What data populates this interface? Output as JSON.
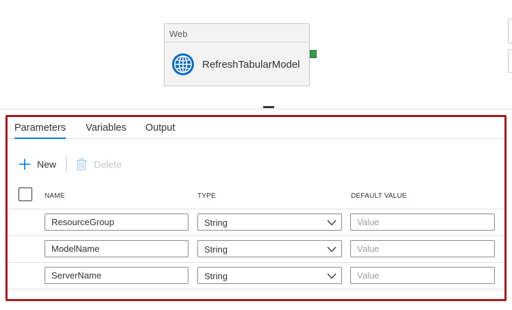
{
  "canvas": {
    "activity": {
      "type_label": "Web",
      "name": "RefreshTabularModel",
      "icon": "globe-icon"
    }
  },
  "panel": {
    "tabs": [
      {
        "label": "Parameters",
        "active": true
      },
      {
        "label": "Variables",
        "active": false
      },
      {
        "label": "Output",
        "active": false
      }
    ],
    "toolbar": {
      "new_label": "New",
      "new_icon": "plus-icon",
      "delete_label": "Delete",
      "delete_icon": "trash-icon"
    },
    "columns": {
      "name": "NAME",
      "type": "TYPE",
      "default": "DEFAULT VALUE"
    },
    "rows": [
      {
        "name": "ResourceGroup",
        "type": "String",
        "default_placeholder": "Value"
      },
      {
        "name": "ModelName",
        "type": "String",
        "default_placeholder": "Value"
      },
      {
        "name": "ServerName",
        "type": "String",
        "default_placeholder": "Value"
      }
    ]
  },
  "colors": {
    "accent": "#0078d4",
    "highlight_border": "#9b1c1f",
    "success_port": "#3a9a4a"
  }
}
